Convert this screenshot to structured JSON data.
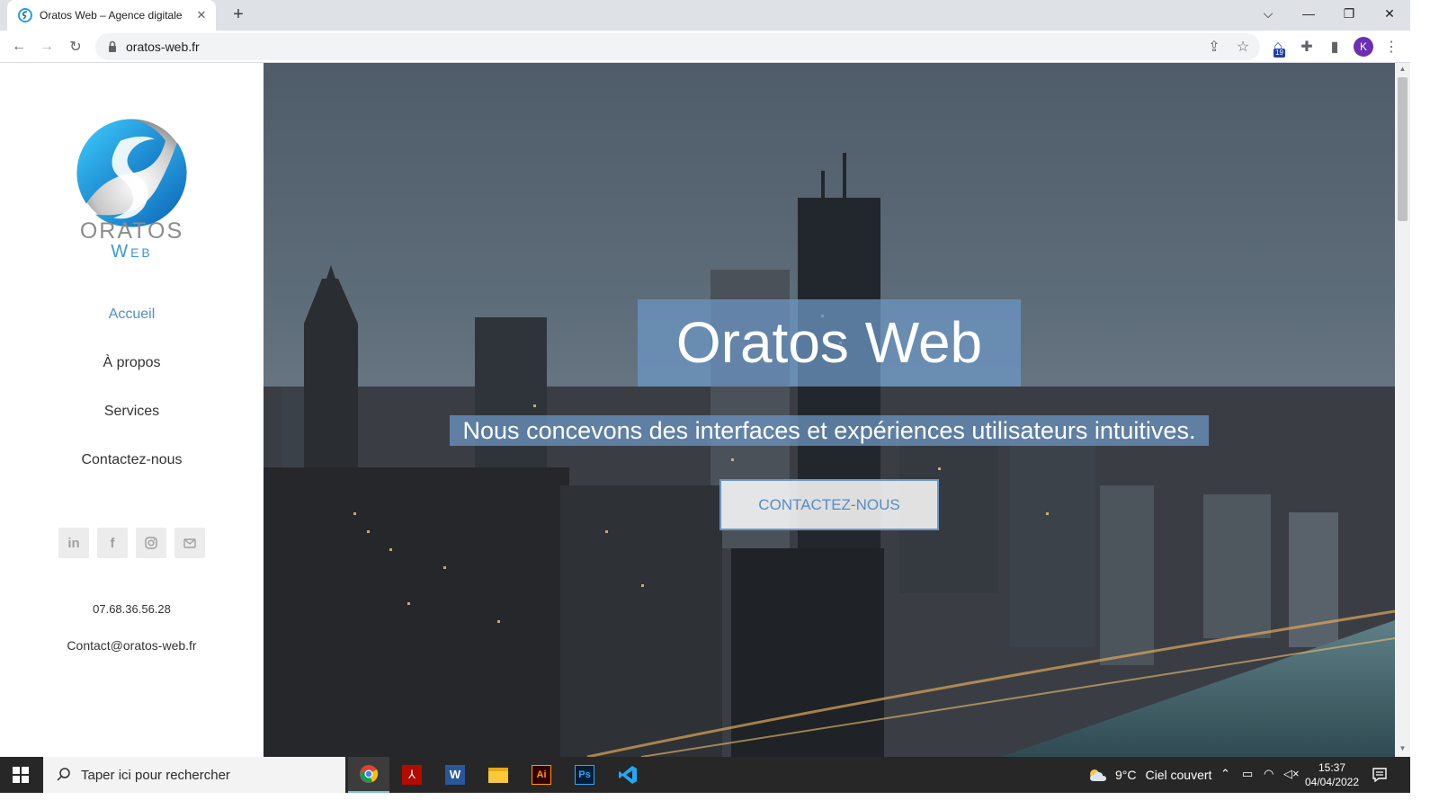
{
  "browser": {
    "tab_title": "Oratos Web – Agence digitale",
    "url": "oratos-web.fr",
    "profile_initial": "K",
    "extension_badge": "19"
  },
  "sidebar": {
    "logo_line1": "ORATOS",
    "logo_line2": "Web",
    "nav": [
      {
        "label": "Accueil"
      },
      {
        "label": "À propos"
      },
      {
        "label": "Services"
      },
      {
        "label": "Contactez-nous"
      }
    ],
    "socials": [
      "linkedin-icon",
      "facebook-icon",
      "instagram-icon",
      "mail-icon"
    ],
    "phone": "07.68.36.56.28",
    "email": "Contact@oratos-web.fr"
  },
  "hero": {
    "title": "Oratos Web",
    "subtitle": "Nous concevons des interfaces et expériences utilisateurs intuitives.",
    "cta": "CONTACTEZ-NOUS"
  },
  "taskbar": {
    "search_placeholder": "Taper ici pour rechercher",
    "weather_temp": "9°C",
    "weather_text": "Ciel couvert",
    "time": "15:37",
    "date": "04/04/2022"
  },
  "colors": {
    "accent": "#4f8fc7",
    "hero_overlay": "#6c96c3",
    "profile": "#6b2fb3"
  }
}
